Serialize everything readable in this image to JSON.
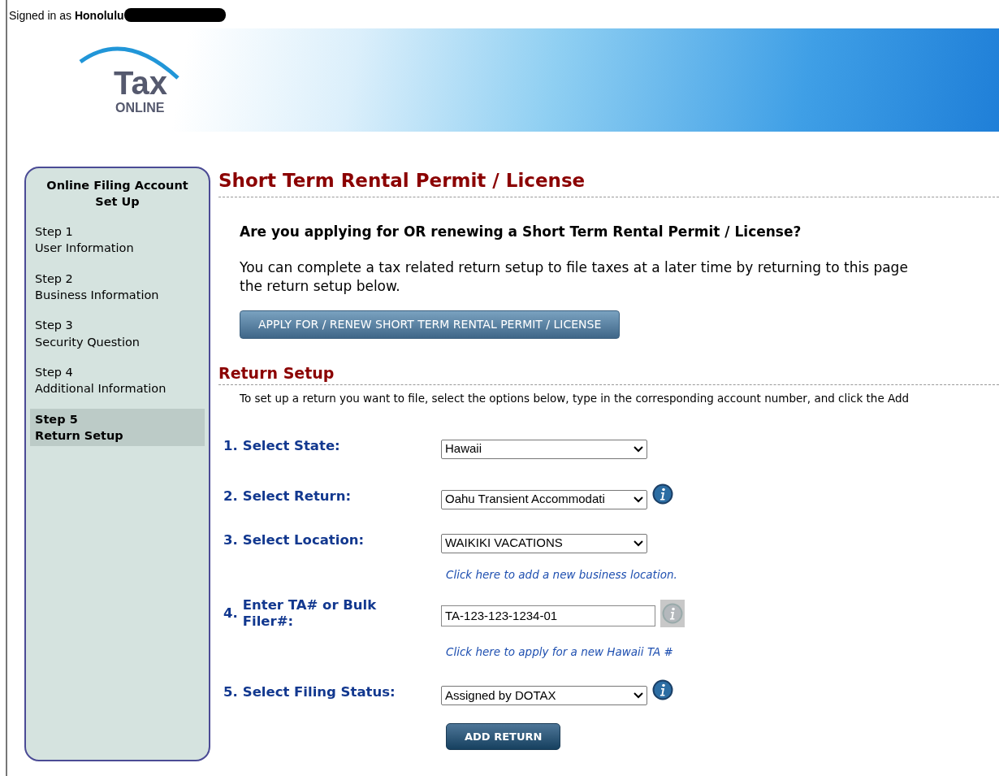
{
  "signed_in": {
    "prefix": "Signed in as",
    "user": "Honolulu"
  },
  "logo": {
    "word": "Tax",
    "sub": "ONLINE"
  },
  "sidebar": {
    "title": "Online Filing Account Set Up",
    "items": [
      {
        "step": "Step 1",
        "label": "User Information",
        "selected": false
      },
      {
        "step": "Step 2",
        "label": "Business Information",
        "selected": false
      },
      {
        "step": "Step 3",
        "label": "Security Question",
        "selected": false
      },
      {
        "step": "Step 4",
        "label": "Additional Information",
        "selected": false
      },
      {
        "step": "Step 5",
        "label": "Return Setup",
        "selected": true
      }
    ]
  },
  "page_title": "Short Term Rental Permit / License",
  "question": "Are you applying for OR renewing a Short Term Rental Permit / License?",
  "intro_lines": [
    "You can complete a tax related return setup to file taxes at a later time by returning to this page",
    "the return setup below."
  ],
  "apply_button": "APPLY FOR / RENEW SHORT TERM RENTAL PERMIT / LICENSE",
  "section_title": "Return Setup",
  "instructions": "To set up a return you want to file, select the options below, type in the corresponding account number, and click the Add",
  "form": [
    {
      "number": "1.",
      "label": "Select State:",
      "kind": "select",
      "value": "Hawaii"
    },
    {
      "number": "2.",
      "label": "Select Return:",
      "kind": "select",
      "value": "Oahu Transient Accommodati",
      "info": true
    },
    {
      "number": "3.",
      "label": "Select Location:",
      "kind": "select",
      "value": "WAIKIKI VACATIONS",
      "link": "Click here to add a new business location."
    },
    {
      "number": "4.",
      "label": "Enter TA# or Bulk Filer#:",
      "kind": "input",
      "value": "TA-123-123-1234-01",
      "info": true,
      "info_disabled": true,
      "link": "Click here to apply for a new Hawaii TA #"
    },
    {
      "number": "5.",
      "label": "Select Filing Status:",
      "kind": "select",
      "value": "Assigned by DOTAX",
      "info": true
    }
  ],
  "add_button": "ADD RETURN"
}
